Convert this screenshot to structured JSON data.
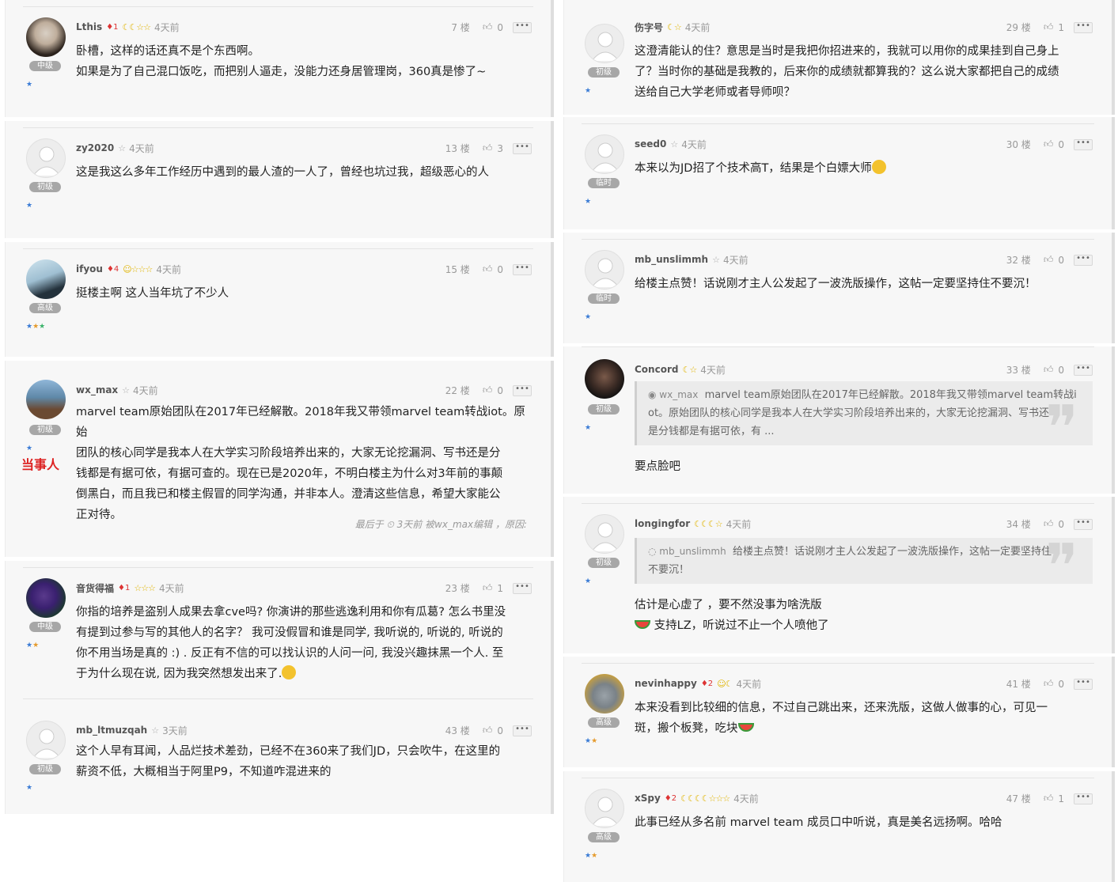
{
  "levels": {
    "mid": "中级",
    "junior": "初级",
    "senior": "高级",
    "temp": "临时"
  },
  "ui": {
    "more": "•••",
    "like_icon": "thumbs-up",
    "dangshiren": "当事人"
  },
  "left": [
    {
      "user": "Lthis",
      "rank": "1",
      "time": "4天前",
      "floor": "7 楼",
      "likes": "0",
      "level": "中级",
      "lines": [
        "卧槽，这样的话还真不是个东西啊。",
        "如果是为了自己混口饭吃，而把别人逼走，没能力还身居管理岗，360真是惨了~"
      ]
    },
    {
      "user": "zy2020",
      "time": "4天前",
      "floor": "13 楼",
      "likes": "3",
      "level": "初级",
      "lines": [
        "这是我这么多年工作经历中遇到的最人渣的一人了，曾经也坑过我，超级恶心的人"
      ]
    },
    {
      "user": "ifyou",
      "rank": "4",
      "time": "4天前",
      "floor": "15 楼",
      "likes": "0",
      "level": "高级",
      "lines": [
        "挺楼主啊 这人当年坑了不少人"
      ]
    },
    {
      "user": "wx_max",
      "time": "4天前",
      "floor": "22 楼",
      "likes": "0",
      "level": "初级",
      "lines": [
        "marvel team原始团队在2017年已经解散。2018年我又带领marvel team转战iot。原始",
        "团队的核心同学是我本人在大学实习阶段培养出来的，大家无论挖漏洞、写书还是分",
        "钱都是有据可依，有据可查的。现在已是2020年，不明白楼主为什么对3年前的事颠",
        "倒黑白，而且我已和楼主假冒的同学沟通，并非本人。澄清这些信息，希望大家能公",
        "正对待。"
      ],
      "edit": "最后于 ⏲ 3天前 被wx_max编辑 ，原因:"
    },
    {
      "user": "音货得福",
      "rank": "1",
      "time": "4天前",
      "floor": "23 楼",
      "likes": "1",
      "level": "中级",
      "lines": [
        "你指的培养是盗别人成果去拿cve吗? 你演讲的那些逃逸利用和你有瓜葛? 怎么书里没",
        "有提到过参与写的其他人的名字？ 我可没假冒和谁是同学, 我听说的, 听说的, 听说的",
        "你不用当场是真的 :) . 反正有不信的可以找认识的人问一问, 我没兴趣抹黑一个人. 至",
        "于为什么现在说, 因为我突然想发出来了."
      ]
    },
    {
      "user": "mb_ltmuzqah",
      "time": "3天前",
      "floor": "43 楼",
      "likes": "0",
      "level": "初级",
      "lines": [
        "这个人早有耳闻，人品烂技术差劲，已经不在360来了我们JD，只会吹牛，在这里的",
        "薪资不低，大概相当于阿里P9，不知道咋混进来的"
      ]
    }
  ],
  "right": [
    {
      "user": "伤字号",
      "time": "4天前",
      "floor": "29 楼",
      "likes": "1",
      "level": "初级",
      "lines": [
        "这澄清能认的住？意思是当时是我把你招进来的，我就可以用你的成果挂到自己身上",
        "了？当时你的基础是我教的，后来你的成绩就都算我的？这么说大家都把自己的成绩",
        "送给自己大学老师或者导师呗？"
      ]
    },
    {
      "user": "seed0",
      "time": "4天前",
      "floor": "30 楼",
      "likes": "0",
      "level": "临时",
      "lines": [
        "本来以为JD招了个技术高T，结果是个白嫖大师"
      ]
    },
    {
      "user": "mb_unslimmh",
      "time": "4天前",
      "floor": "32 楼",
      "likes": "0",
      "level": "临时",
      "lines": [
        "给楼主点赞！话说刚才主人公发起了一波洗版操作，这帖一定要坚持住不要沉！"
      ]
    },
    {
      "user": "Concord",
      "time": "4天前",
      "floor": "33 楼",
      "likes": "0",
      "level": "初级",
      "quote_user": "wx_max",
      "quote": [
        "marvel team原始团队在2017年已经解散。2018年我又带领marvel team转战i",
        "ot。原始团队的核心同学是我本人在大学实习阶段培养出来的，大家无论挖漏洞、写书还",
        "是分钱都是有据可依，有 ..."
      ],
      "lines": [
        "要点脸吧"
      ]
    },
    {
      "user": "longingfor",
      "time": "4天前",
      "floor": "34 楼",
      "likes": "0",
      "level": "初级",
      "quote_user": "mb_unslimmh",
      "quote": [
        "给楼主点赞！话说刚才主人公发起了一波洗版操作，这帖一定要坚持住",
        "不要沉！"
      ],
      "lines": [
        "估计是心虚了 ，要不然没事为啥洗版",
        "支持LZ，听说过不止一个人喷他了"
      ]
    },
    {
      "user": "nevinhappy",
      "rank": "2",
      "time": "4天前",
      "floor": "41 楼",
      "likes": "0",
      "level": "高级",
      "lines": [
        "本来没看到比较细的信息，不过自己跳出来，还来洗版，这做人做事的心，可见一",
        "斑，搬个板凳，吃块"
      ]
    },
    {
      "user": "xSpy",
      "rank": "2",
      "time": "4天前",
      "floor": "47 楼",
      "likes": "1",
      "level": "高级",
      "lines": [
        "此事已经从多名前 marvel team  成员口中听说，真是美名远扬啊。哈哈"
      ]
    }
  ]
}
